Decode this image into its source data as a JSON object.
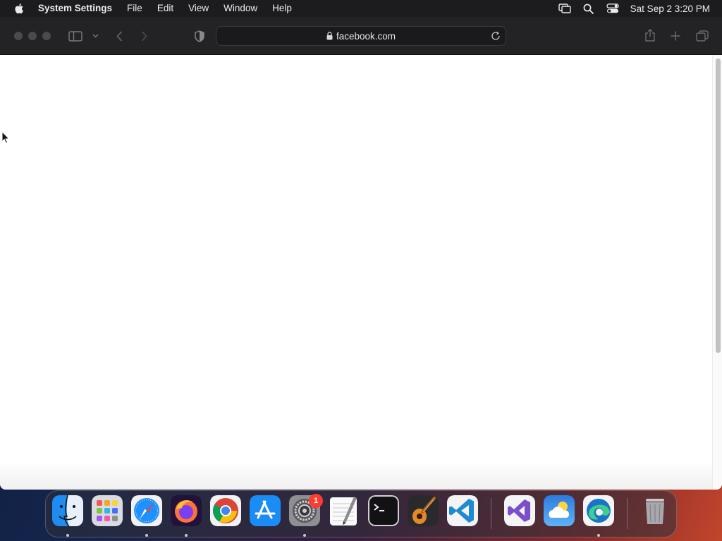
{
  "menubar": {
    "app_name": "System Settings",
    "menus": [
      "File",
      "Edit",
      "View",
      "Window",
      "Help"
    ],
    "icons": [
      "apple-icon",
      "screen-mirroring-icon",
      "spotlight-search-icon",
      "control-center-icon"
    ],
    "clock": "Sat Sep 2  3:20 PM"
  },
  "browser": {
    "url": "facebook.com",
    "icons": [
      "sidebar-toggle-icon",
      "chevron-down-icon",
      "back-icon",
      "forward-icon",
      "shield-icon",
      "lock-icon",
      "reload-icon",
      "share-icon",
      "new-tab-icon",
      "tab-overview-icon"
    ]
  },
  "dock": {
    "apps": [
      "Finder",
      "Launchpad",
      "Safari",
      "Firefox",
      "Google Chrome",
      "App Store",
      "System Settings",
      "TextEdit",
      "Terminal",
      "GarageBand",
      "Visual Studio Code",
      "Visual Studio",
      "Weather",
      "Microsoft Edge",
      "Trash"
    ],
    "system_settings_badge": "1"
  },
  "colors": {
    "menubar_bg": "#1c1c1e",
    "toolbar_bg": "#232325",
    "page_bg": "#ffffff",
    "badge": "#ff3b30"
  }
}
